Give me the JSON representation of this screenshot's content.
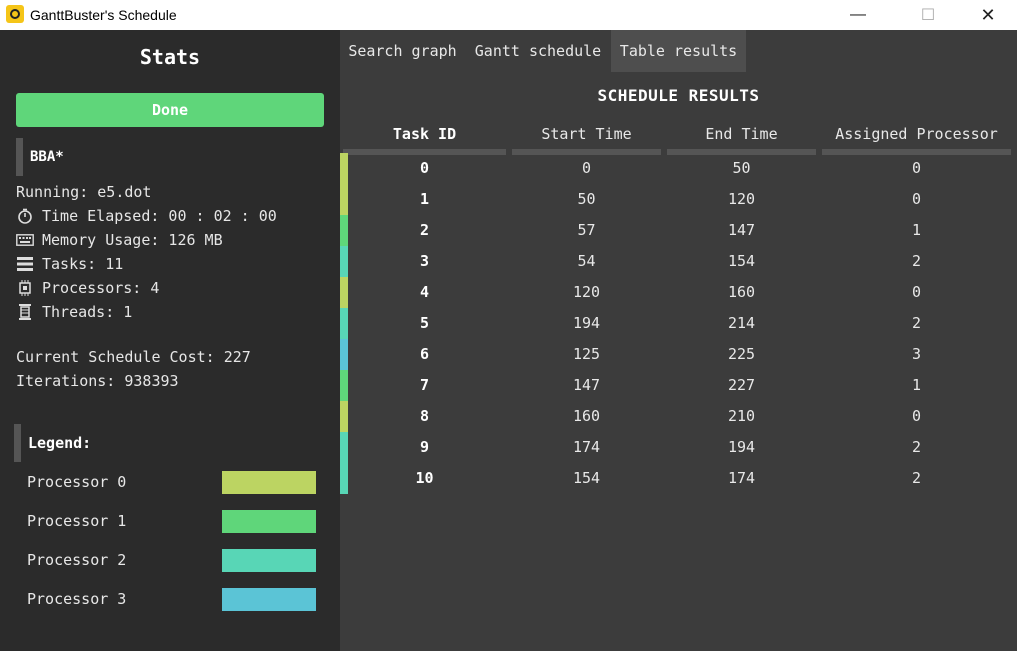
{
  "window": {
    "title": "GanttBuster's Schedule",
    "minimize": "—",
    "maximize": "☐",
    "close": "✕"
  },
  "sidebar": {
    "title": "Stats",
    "done_label": "Done",
    "algorithm": "BBA*",
    "running": "Running: e5.dot",
    "time_elapsed": "Time Elapsed: 00 : 02 : 00",
    "memory_usage": "Memory Usage: 126 MB",
    "tasks": "Tasks: 11",
    "processors": "Processors: 4",
    "threads": "Threads: 1",
    "schedule_cost": "Current Schedule Cost: 227",
    "iterations": "Iterations: 938393",
    "legend_title": "Legend:",
    "legend": [
      {
        "label": "Processor 0",
        "color": "#bcd462"
      },
      {
        "label": "Processor 1",
        "color": "#5fd67a"
      },
      {
        "label": "Processor 2",
        "color": "#58d6b6"
      },
      {
        "label": "Processor 3",
        "color": "#5bc4d6"
      }
    ],
    "icons": [
      "stopwatch-icon",
      "keyboard-icon",
      "tasks-icon",
      "processor-icon",
      "threads-icon"
    ]
  },
  "tabs": [
    {
      "label": "Search graph",
      "active": false
    },
    {
      "label": "Gantt schedule",
      "active": false
    },
    {
      "label": "Table results",
      "active": true
    }
  ],
  "results": {
    "title": "SCHEDULE RESULTS",
    "columns": [
      "Task ID",
      "Start Time",
      "End Time",
      "Assigned Processor"
    ],
    "rows": [
      [
        "0",
        "0",
        "50",
        "0"
      ],
      [
        "1",
        "50",
        "120",
        "0"
      ],
      [
        "2",
        "57",
        "147",
        "1"
      ],
      [
        "3",
        "54",
        "154",
        "2"
      ],
      [
        "4",
        "120",
        "160",
        "0"
      ],
      [
        "5",
        "194",
        "214",
        "2"
      ],
      [
        "6",
        "125",
        "225",
        "3"
      ],
      [
        "7",
        "147",
        "227",
        "1"
      ],
      [
        "8",
        "160",
        "210",
        "0"
      ],
      [
        "9",
        "174",
        "194",
        "2"
      ],
      [
        "10",
        "154",
        "174",
        "2"
      ]
    ]
  }
}
